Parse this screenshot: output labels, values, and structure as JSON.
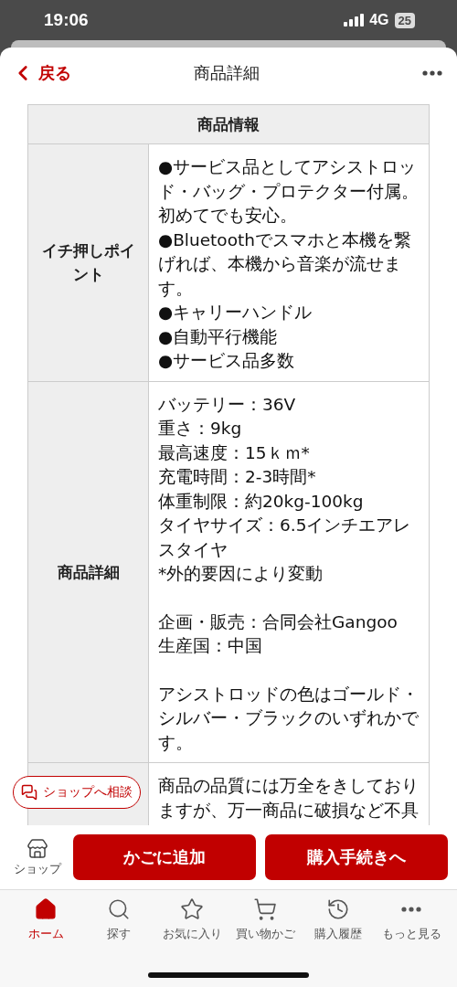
{
  "status_bar": {
    "time": "19:06",
    "network": "4G",
    "battery": "25"
  },
  "header": {
    "back": "戻る",
    "title": "商品詳細"
  },
  "table": {
    "heading": "商品情報",
    "rows": [
      {
        "label": "イチ押しポイント",
        "paragraphs": [
          [
            "●サービス品としてアシストロッド・バッグ・プロテクター付属。初めてでも安心。",
            "●Bluetoothでスマホと本機を繋げれば、本機から音楽が流せます。",
            "●キャリーハンドル",
            "●自動平行機能",
            "●サービス品多数"
          ]
        ]
      },
      {
        "label": "商品詳細",
        "paragraphs": [
          [
            "バッテリー：36V",
            "重さ：9kg",
            "最高速度：15ｋｍ*",
            "充電時間：2-3時間*",
            "体重制限：約20kg-100kg",
            "タイヤサイズ：6.5インチエアレスタイヤ",
            "*外的要因により変動"
          ],
          [
            "企画・販売：合同会社Gangoo",
            "生産国：中国"
          ],
          [
            "アシストロッドの色はゴールド・シルバー・ブラックのいずれかです。"
          ]
        ]
      },
      {
        "paragraphs": [
          [
            "商品の品質には万全をきしておりますが、万一商品に破損など不具"
          ]
        ]
      }
    ]
  },
  "consult_button": "ショップへ相談",
  "action_bar": {
    "shop": "ショップ",
    "add_to_cart": "かごに追加",
    "checkout": "購入手続きへ"
  },
  "tab_bar": [
    {
      "kind": "home",
      "label": "ホーム",
      "selected": true
    },
    {
      "kind": "search",
      "label": "探す",
      "selected": false
    },
    {
      "kind": "favorite",
      "label": "お気に入り",
      "selected": false
    },
    {
      "kind": "cart",
      "label": "買い物かご",
      "selected": false
    },
    {
      "kind": "history",
      "label": "購入履歴",
      "selected": false
    },
    {
      "kind": "more",
      "label": "もっと見る",
      "selected": false
    }
  ]
}
